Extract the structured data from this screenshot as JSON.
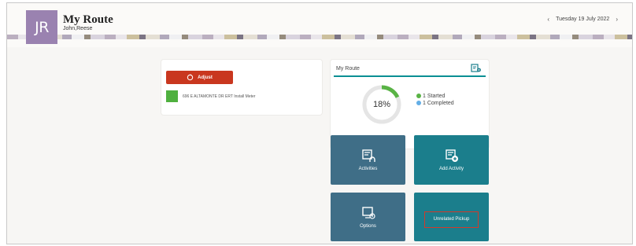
{
  "header": {
    "avatar_initials": "JR",
    "title": "My Route",
    "user": "John,Reese",
    "date": "Tuesday 19 July 2022",
    "prev_icon": "chevron-left-icon",
    "next_icon": "chevron-right-icon"
  },
  "adjust_panel": {
    "adjust_label": "Adjust",
    "task_label": "696 E ALTAMONTE DR ERT Install Meter",
    "task_color": "#4fb03f",
    "adjust_color": "#c9371f"
  },
  "route_card": {
    "title": "My Route",
    "progress_percent": 18,
    "progress_label": "18%",
    "started_label": "1 Started",
    "completed_label": "1 Completed",
    "started_color": "#59b345",
    "completed_color": "#63aee6",
    "accent_color": "#0b8f94"
  },
  "tiles": {
    "activities": "Activities",
    "add_activity": "Add Activity",
    "options": "Options",
    "unrelated_pickup": "Unrelated Pickup"
  }
}
